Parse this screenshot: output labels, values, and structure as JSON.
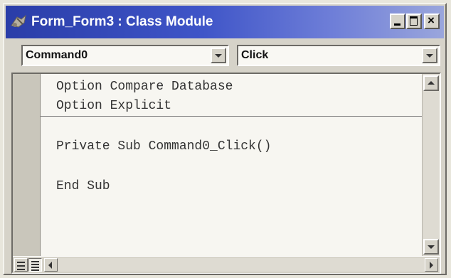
{
  "window": {
    "title": "Form_Form3 : Class Module",
    "minimize_icon": "minimize-icon",
    "maximize_icon": "maximize-icon",
    "close_icon": "close-icon",
    "close_glyph": "×"
  },
  "toolbar": {
    "object_value": "Command0",
    "procedure_value": "Click"
  },
  "code": {
    "declarations": [
      "Option Compare Database",
      "Option Explicit"
    ],
    "procedure": [
      "Private Sub Command0_Click()",
      "",
      "End Sub"
    ]
  },
  "colors": {
    "titlebar_start": "#2a3da8",
    "titlebar_end": "#9aa6dc",
    "chrome": "#d6d3c9",
    "code_background": "#f7f6f1"
  }
}
